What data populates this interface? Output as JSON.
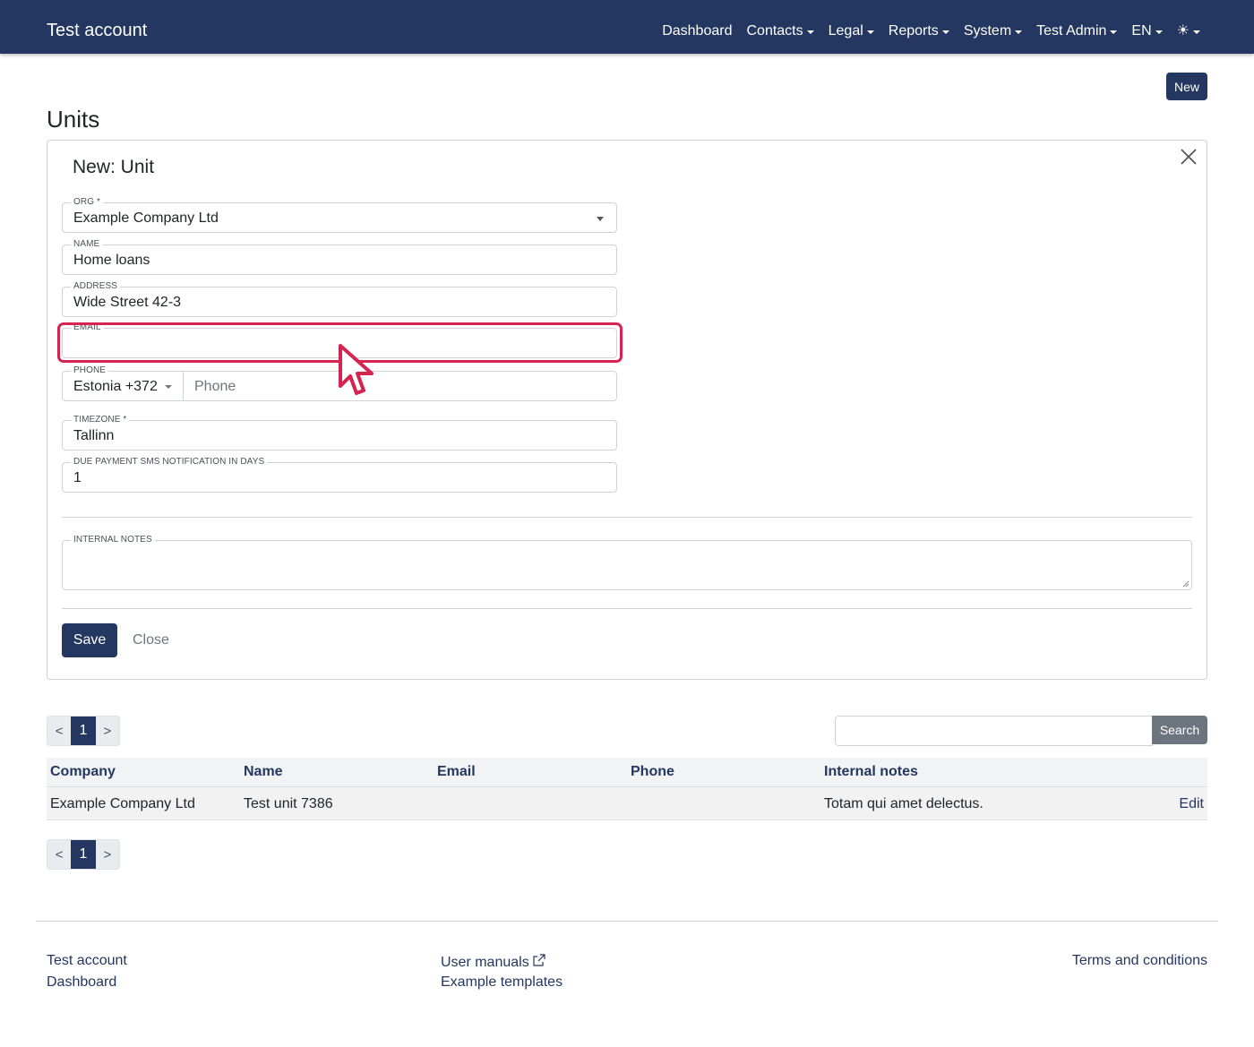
{
  "navbar": {
    "brand": "Test account",
    "items": [
      {
        "label": "Dashboard",
        "dropdown": false
      },
      {
        "label": "Contacts",
        "dropdown": true
      },
      {
        "label": "Legal",
        "dropdown": true
      },
      {
        "label": "Reports",
        "dropdown": true
      },
      {
        "label": "System",
        "dropdown": true
      },
      {
        "label": "Test Admin",
        "dropdown": true
      },
      {
        "label": "EN",
        "dropdown": true
      }
    ],
    "theme_icon": "sun-icon",
    "theme_glyph": "☀"
  },
  "page": {
    "title": "Units",
    "new_button": "New"
  },
  "form": {
    "title": "New: Unit",
    "close_icon": "close-icon",
    "fields": {
      "org": {
        "label": "ORG *",
        "value": "Example Company Ltd"
      },
      "name": {
        "label": "NAME",
        "value": "Home loans"
      },
      "address": {
        "label": "ADDRESS",
        "value": "Wide Street 42-3"
      },
      "email": {
        "label": "EMAIL",
        "value": ""
      },
      "phone": {
        "label": "PHONE",
        "country": "Estonia +372",
        "placeholder": "Phone",
        "value": ""
      },
      "timezone": {
        "label": "TIMEZONE *",
        "value": "Tallinn"
      },
      "due_payment": {
        "label": "DUE PAYMENT SMS NOTIFICATION IN DAYS",
        "value": "1"
      },
      "internal_notes": {
        "label": "INTERNAL NOTES",
        "value": ""
      }
    },
    "save_label": "Save",
    "close_label": "Close"
  },
  "pagination": {
    "prev": "<",
    "current": "1",
    "next": ">"
  },
  "search": {
    "value": "",
    "button": "Search"
  },
  "table": {
    "columns": [
      "Company",
      "Name",
      "Email",
      "Phone",
      "Internal notes"
    ],
    "rows": [
      {
        "company": "Example Company Ltd",
        "name": "Test unit 7386",
        "email": "",
        "phone": "",
        "notes": "Totam qui amet delectus.",
        "action": "Edit"
      }
    ]
  },
  "footer": {
    "col1": [
      "Test account",
      "Dashboard"
    ],
    "col2": [
      "User manuals",
      "Example templates"
    ],
    "col3": [
      "Terms and conditions"
    ]
  },
  "colors": {
    "primary": "#233760",
    "highlight": "#d7234f",
    "secondary": "#6c757d"
  }
}
